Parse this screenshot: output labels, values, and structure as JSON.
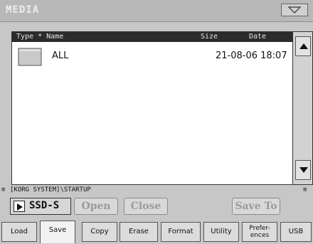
{
  "window": {
    "title": "MEDIA"
  },
  "list": {
    "headers": {
      "type_name": "Type * Name",
      "size": "Size",
      "date": "Date"
    },
    "rows": [
      {
        "name": "ALL",
        "date": "21-08-06 18:07",
        "icon": "folder-icon"
      }
    ]
  },
  "path": {
    "left_marker": "≡",
    "text": "[KORG SYSTEM]\\STARTUP",
    "right_marker": "≡"
  },
  "device": {
    "label": "SSD-S"
  },
  "buttons": {
    "open": "Open",
    "close": "Close",
    "save_to": "Save To"
  },
  "tabs": [
    {
      "label": "Load",
      "active": false
    },
    {
      "label": "Save",
      "active": true
    },
    {
      "label": "Copy",
      "active": false
    },
    {
      "label": "Erase",
      "active": false
    },
    {
      "label": "Format",
      "active": false
    },
    {
      "label": "Utility",
      "active": false
    },
    {
      "label": "Prefer-\nences",
      "active": false
    },
    {
      "label": "USB",
      "active": false
    }
  ],
  "colors": {
    "background": "#c7c7c7",
    "header_bg": "#2b2b2b",
    "list_bg": "#ffffff",
    "disabled_text": "#9a9a9a"
  }
}
